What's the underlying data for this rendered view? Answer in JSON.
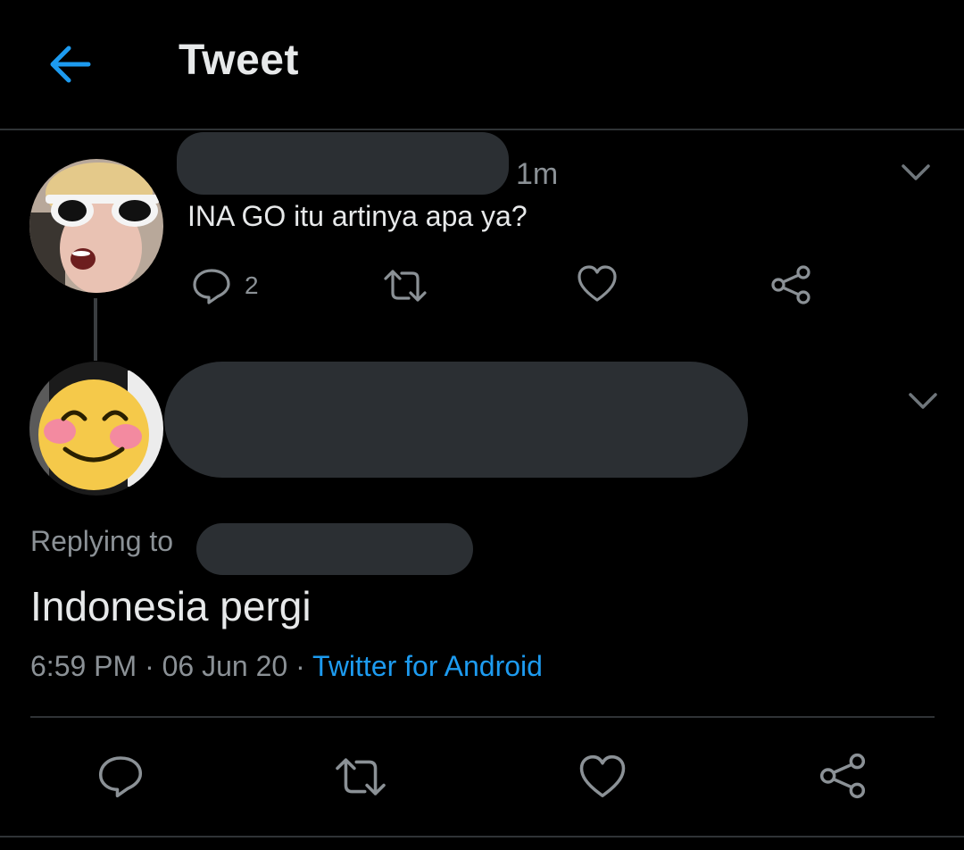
{
  "header": {
    "title": "Tweet"
  },
  "parent_tweet": {
    "time": "1m",
    "text": "INA GO itu artinya apa ya?",
    "reply_count": "2"
  },
  "main_tweet": {
    "replying_label": "Replying to",
    "text": "Indonesia pergi",
    "time": "6:59 PM",
    "date": "06 Jun 20",
    "source": "Twitter for Android",
    "separator": "·"
  },
  "colors": {
    "accent": "#1d9bf0",
    "background": "#000000",
    "muted": "#8b9196",
    "redaction": "#2b2f33"
  },
  "icons": [
    "back-arrow-icon",
    "chevron-down-icon",
    "reply-icon",
    "retweet-icon",
    "like-icon",
    "share-icon"
  ]
}
